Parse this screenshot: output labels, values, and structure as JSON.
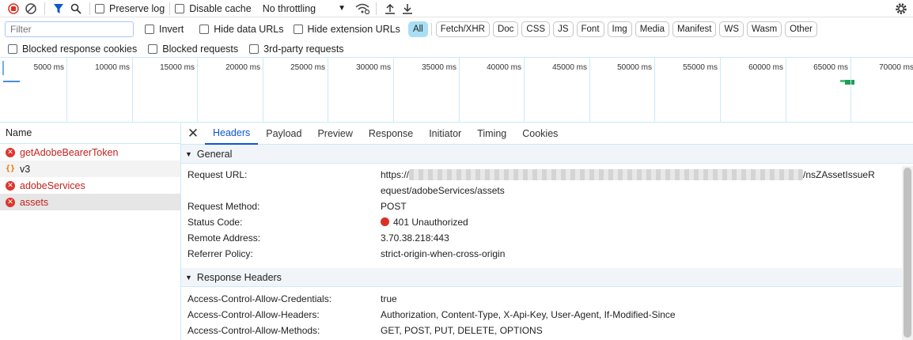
{
  "toolbar": {
    "preserve_log": "Preserve log",
    "disable_cache": "Disable cache",
    "throttling": "No throttling"
  },
  "filterbar": {
    "placeholder": "Filter",
    "invert": "Invert",
    "hide_data_urls": "Hide data URLs",
    "hide_extension_urls": "Hide extension URLs",
    "types": [
      "All",
      "Fetch/XHR",
      "Doc",
      "CSS",
      "JS",
      "Font",
      "Img",
      "Media",
      "Manifest",
      "WS",
      "Wasm",
      "Other"
    ],
    "active_type": "All"
  },
  "blockbar": {
    "blocked_cookies": "Blocked response cookies",
    "blocked_requests": "Blocked requests",
    "third_party": "3rd-party requests"
  },
  "overview": {
    "ticks": [
      "5000 ms",
      "10000 ms",
      "15000 ms",
      "20000 ms",
      "25000 ms",
      "30000 ms",
      "35000 ms",
      "40000 ms",
      "45000 ms",
      "50000 ms",
      "55000 ms",
      "60000 ms",
      "65000 ms",
      "70000 ms"
    ]
  },
  "requests": {
    "header": "Name",
    "items": [
      {
        "name": "getAdobeBearerToken",
        "status": "error"
      },
      {
        "name": "v3",
        "status": "json"
      },
      {
        "name": "adobeServices",
        "status": "error"
      },
      {
        "name": "assets",
        "status": "error"
      }
    ]
  },
  "tabs": [
    "Headers",
    "Payload",
    "Preview",
    "Response",
    "Initiator",
    "Timing",
    "Cookies"
  ],
  "active_tab": "Headers",
  "general": {
    "title": "General",
    "request_url_key": "Request URL:",
    "request_url_line1": "https://",
    "request_url_tail1": "/nsZAssetIssueR",
    "request_url_line2": "equest/adobeServices/assets",
    "rows": [
      {
        "k": "Request Method:",
        "v": "POST"
      },
      {
        "k": "Status Code:",
        "v": "401 Unauthorized"
      },
      {
        "k": "Remote Address:",
        "v": "3.70.38.218:443"
      },
      {
        "k": "Referrer Policy:",
        "v": "strict-origin-when-cross-origin"
      }
    ]
  },
  "response_headers": {
    "title": "Response Headers",
    "rows": [
      {
        "k": "Access-Control-Allow-Credentials:",
        "v": "true"
      },
      {
        "k": "Access-Control-Allow-Headers:",
        "v": "Authorization, Content-Type, X-Api-Key, User-Agent, If-Modified-Since"
      },
      {
        "k": "Access-Control-Allow-Methods:",
        "v": "GET, POST, PUT, DELETE, OPTIONS"
      }
    ]
  },
  "colors": {
    "accent": "#0b57d0",
    "error": "#dc362e",
    "record": "#d93025"
  }
}
